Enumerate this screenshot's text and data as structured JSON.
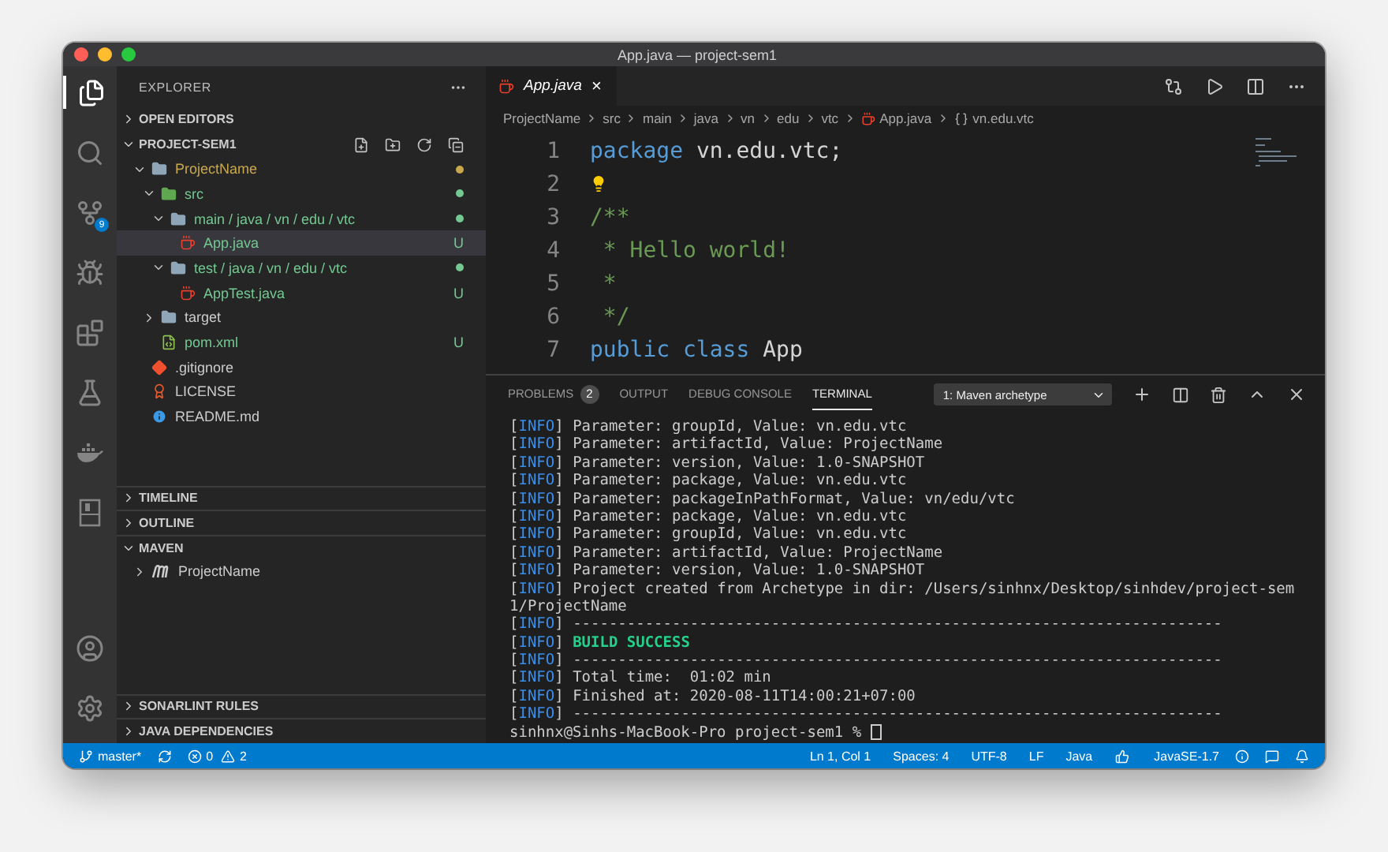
{
  "window": {
    "title": "App.java — project-sem1"
  },
  "activity_bar": {
    "badge": "9"
  },
  "sidebar": {
    "title": "EXPLORER",
    "sections": [
      {
        "title": "OPEN EDITORS",
        "expanded": false,
        "toolbar": false
      },
      {
        "title": "PROJECT-SEM1",
        "expanded": true,
        "toolbar": true,
        "tree": [
          {
            "label": "ProjectName",
            "kind": "folder",
            "expanded": true,
            "selected": false,
            "color": "#c9a84c",
            "dot": true,
            "children": [
              {
                "label": "src",
                "kind": "src",
                "expanded": true,
                "selected": false,
                "color": "#73c991",
                "dot": true,
                "children": [
                  {
                    "label": "main / java / vn / edu / vtc",
                    "kind": "folder",
                    "expanded": true,
                    "selected": false,
                    "color": "#73c991",
                    "dot": true,
                    "children": [
                      {
                        "label": "App.java",
                        "kind": "java",
                        "selected": true,
                        "color": "#73c991",
                        "badge": "U"
                      }
                    ]
                  },
                  {
                    "label": "test / java / vn / edu / vtc",
                    "kind": "folder",
                    "expanded": true,
                    "selected": false,
                    "color": "#73c991",
                    "dot": true,
                    "children": [
                      {
                        "label": "AppTest.java",
                        "kind": "java",
                        "selected": false,
                        "color": "#73c991",
                        "badge": "U"
                      }
                    ]
                  }
                ]
              },
              {
                "label": "target",
                "kind": "folder",
                "expanded": false,
                "selected": false
              },
              {
                "label": "pom.xml",
                "kind": "xml",
                "selected": false,
                "color": "#73c991",
                "badge": "U"
              }
            ]
          },
          {
            "label": ".gitignore",
            "kind": "git",
            "selected": false
          },
          {
            "label": "LICENSE",
            "kind": "license",
            "selected": false
          },
          {
            "label": "README.md",
            "kind": "info",
            "selected": false
          }
        ]
      },
      {
        "title": "TIMELINE",
        "expanded": false,
        "toolbar": false
      },
      {
        "title": "OUTLINE",
        "expanded": false,
        "toolbar": false
      },
      {
        "title": "MAVEN",
        "expanded": true,
        "toolbar": false,
        "tree": [
          {
            "label": "ProjectName",
            "kind": "maven",
            "expanded": false,
            "selected": false
          }
        ]
      },
      {
        "title": "SONARLINT RULES",
        "expanded": false,
        "toolbar": false
      },
      {
        "title": "JAVA DEPENDENCIES",
        "expanded": false,
        "toolbar": false
      }
    ]
  },
  "editor": {
    "tabs": [
      {
        "label": "App.java",
        "selected": true,
        "close": "×"
      }
    ],
    "breadcrumbs": [
      "ProjectName",
      "src",
      "main",
      "java",
      "vn",
      "edu",
      "vtc",
      "App.java",
      "vn.edu.vtc"
    ],
    "lines": [
      {
        "n": "1",
        "lightbulb": false,
        "tokens": [
          {
            "text": "package",
            "kind": "keyword"
          },
          {
            "text": " vn.edu.vtc;",
            "kind": "plain"
          }
        ]
      },
      {
        "n": "2",
        "lightbulb": true
      },
      {
        "n": "3",
        "lightbulb": false,
        "tokens": [
          {
            "text": "/**",
            "kind": "comment"
          }
        ]
      },
      {
        "n": "4",
        "lightbulb": false,
        "tokens": [
          {
            "text": " * Hello world!",
            "kind": "comment"
          }
        ]
      },
      {
        "n": "5",
        "lightbulb": false,
        "tokens": [
          {
            "text": " *",
            "kind": "comment"
          }
        ]
      },
      {
        "n": "6",
        "lightbulb": false,
        "tokens": [
          {
            "text": " */",
            "kind": "comment"
          }
        ]
      },
      {
        "n": "7",
        "lightbulb": false,
        "tokens": [
          {
            "text": "public",
            "kind": "keyword"
          },
          {
            "text": " class",
            "kind": "keyword"
          },
          {
            "text": " App",
            "kind": "plain"
          }
        ]
      }
    ]
  },
  "panel": {
    "tabs": [
      {
        "label": "PROBLEMS",
        "count": "2",
        "selected": false
      },
      {
        "label": "OUTPUT",
        "selected": false
      },
      {
        "label": "DEBUG CONSOLE",
        "selected": false
      },
      {
        "label": "TERMINAL",
        "selected": true
      }
    ],
    "terminal_select": "1: Maven archetype",
    "lines": [
      [
        {
          "text": "[",
          "kind": "plain"
        },
        {
          "text": "INFO",
          "kind": "info"
        },
        {
          "text": "] Parameter: groupId, Value: vn.edu.vtc",
          "kind": "plain"
        }
      ],
      [
        {
          "text": "[",
          "kind": "plain"
        },
        {
          "text": "INFO",
          "kind": "info"
        },
        {
          "text": "] Parameter: artifactId, Value: ProjectName",
          "kind": "plain"
        }
      ],
      [
        {
          "text": "[",
          "kind": "plain"
        },
        {
          "text": "INFO",
          "kind": "info"
        },
        {
          "text": "] Parameter: version, Value: 1.0-SNAPSHOT",
          "kind": "plain"
        }
      ],
      [
        {
          "text": "[",
          "kind": "plain"
        },
        {
          "text": "INFO",
          "kind": "info"
        },
        {
          "text": "] Parameter: package, Value: vn.edu.vtc",
          "kind": "plain"
        }
      ],
      [
        {
          "text": "[",
          "kind": "plain"
        },
        {
          "text": "INFO",
          "kind": "info"
        },
        {
          "text": "] Parameter: packageInPathFormat, Value: vn/edu/vtc",
          "kind": "plain"
        }
      ],
      [
        {
          "text": "[",
          "kind": "plain"
        },
        {
          "text": "INFO",
          "kind": "info"
        },
        {
          "text": "] Parameter: package, Value: vn.edu.vtc",
          "kind": "plain"
        }
      ],
      [
        {
          "text": "[",
          "kind": "plain"
        },
        {
          "text": "INFO",
          "kind": "info"
        },
        {
          "text": "] Parameter: groupId, Value: vn.edu.vtc",
          "kind": "plain"
        }
      ],
      [
        {
          "text": "[",
          "kind": "plain"
        },
        {
          "text": "INFO",
          "kind": "info"
        },
        {
          "text": "] Parameter: artifactId, Value: ProjectName",
          "kind": "plain"
        }
      ],
      [
        {
          "text": "[",
          "kind": "plain"
        },
        {
          "text": "INFO",
          "kind": "info"
        },
        {
          "text": "] Parameter: version, Value: 1.0-SNAPSHOT",
          "kind": "plain"
        }
      ],
      [
        {
          "text": "[",
          "kind": "plain"
        },
        {
          "text": "INFO",
          "kind": "info"
        },
        {
          "text": "] Project created from Archetype in dir: /Users/sinhnx/Desktop/sinhdev/project-sem",
          "kind": "plain"
        }
      ],
      [
        {
          "text": "1/ProjectName",
          "kind": "plain"
        }
      ],
      [
        {
          "text": "[",
          "kind": "plain"
        },
        {
          "text": "INFO",
          "kind": "info"
        },
        {
          "text": "] ------------------------------------------------------------------------",
          "kind": "plain"
        }
      ],
      [
        {
          "text": "[",
          "kind": "plain"
        },
        {
          "text": "INFO",
          "kind": "info"
        },
        {
          "text": "] ",
          "kind": "plain"
        },
        {
          "text": "BUILD SUCCESS",
          "kind": "success"
        }
      ],
      [
        {
          "text": "[",
          "kind": "plain"
        },
        {
          "text": "INFO",
          "kind": "info"
        },
        {
          "text": "] ------------------------------------------------------------------------",
          "kind": "plain"
        }
      ],
      [
        {
          "text": "[",
          "kind": "plain"
        },
        {
          "text": "INFO",
          "kind": "info"
        },
        {
          "text": "] Total time:  01:02 min",
          "kind": "plain"
        }
      ],
      [
        {
          "text": "[",
          "kind": "plain"
        },
        {
          "text": "INFO",
          "kind": "info"
        },
        {
          "text": "] Finished at: 2020-08-11T14:00:21+07:00",
          "kind": "plain"
        }
      ],
      [
        {
          "text": "[",
          "kind": "plain"
        },
        {
          "text": "INFO",
          "kind": "info"
        },
        {
          "text": "] ------------------------------------------------------------------------",
          "kind": "plain"
        }
      ]
    ],
    "prompt": "sinhnx@Sinhs-MacBook-Pro project-sem1 %"
  },
  "status_bar": {
    "branch": "master*",
    "errors": "0",
    "warnings": "2",
    "right": [
      "Ln 1, Col 1",
      "Spaces: 4",
      "UTF-8",
      "LF",
      "Java"
    ],
    "runtime": "JavaSE-1.7"
  }
}
